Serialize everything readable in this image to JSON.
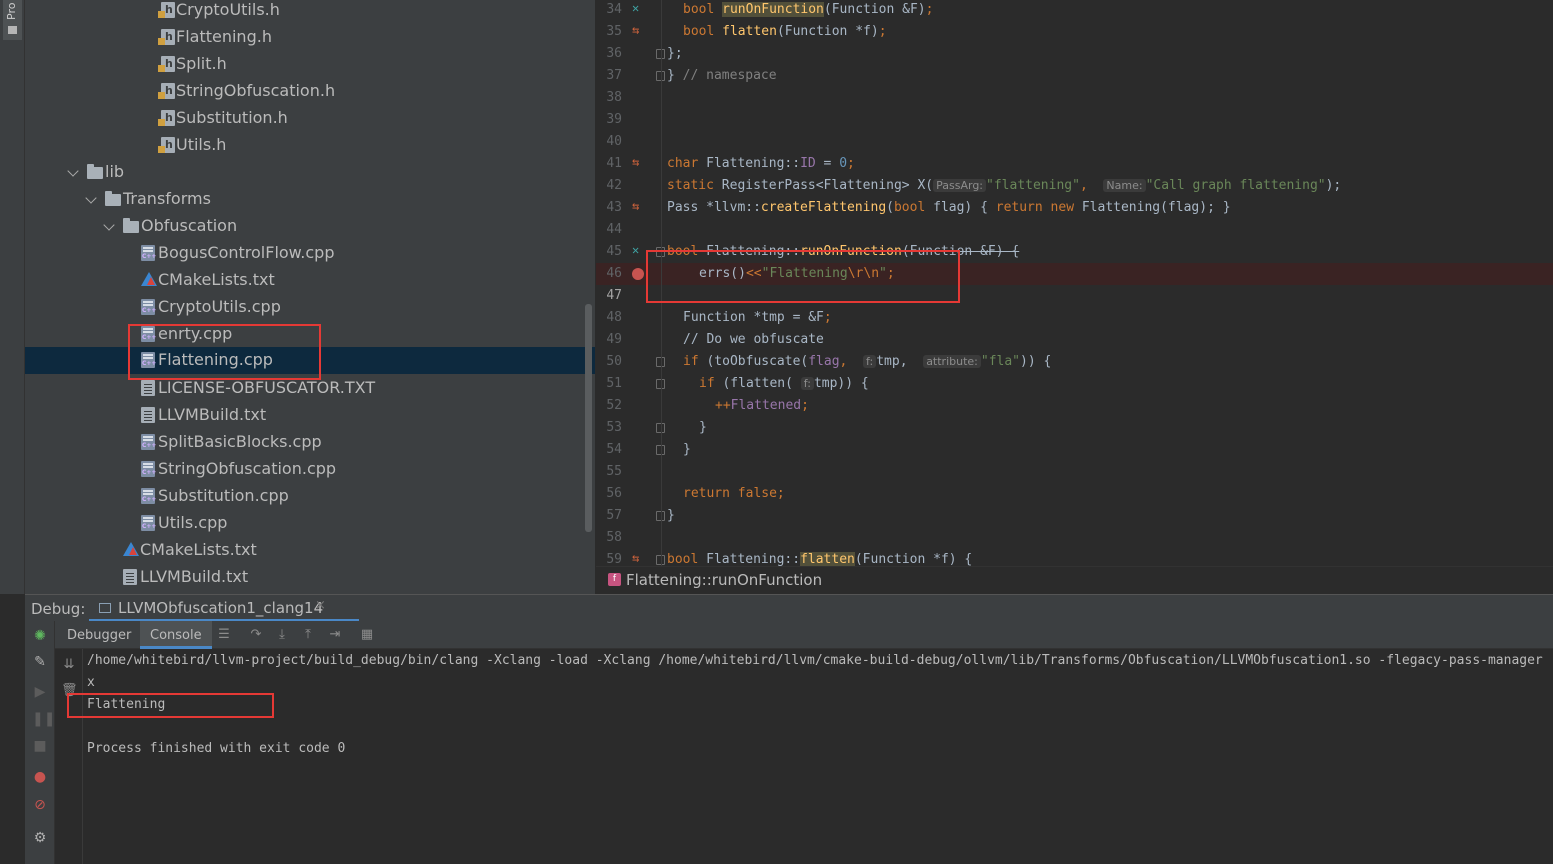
{
  "side_tab": {
    "label": "Pro"
  },
  "tree": {
    "rows": [
      {
        "label": "CryptoUtils.h",
        "type": "h"
      },
      {
        "label": "Flattening.h",
        "type": "h"
      },
      {
        "label": "Split.h",
        "type": "h"
      },
      {
        "label": "StringObfuscation.h",
        "type": "h"
      },
      {
        "label": "Substitution.h",
        "type": "h"
      },
      {
        "label": "Utils.h",
        "type": "h"
      },
      {
        "label": "lib",
        "type": "folder"
      },
      {
        "label": "Transforms",
        "type": "folder"
      },
      {
        "label": "Obfuscation",
        "type": "folder"
      },
      {
        "label": "BogusControlFlow.cpp",
        "type": "cpp"
      },
      {
        "label": "CMakeLists.txt",
        "type": "cmake"
      },
      {
        "label": "CryptoUtils.cpp",
        "type": "cpp"
      },
      {
        "label": "enrty.cpp",
        "type": "cpp"
      },
      {
        "label": "Flattening.cpp",
        "type": "cpp",
        "selected": true
      },
      {
        "label": "LICENSE-OBFUSCATOR.TXT",
        "type": "txt"
      },
      {
        "label": "LLVMBuild.txt",
        "type": "txt"
      },
      {
        "label": "SplitBasicBlocks.cpp",
        "type": "cpp"
      },
      {
        "label": "StringObfuscation.cpp",
        "type": "cpp"
      },
      {
        "label": "Substitution.cpp",
        "type": "cpp"
      },
      {
        "label": "Utils.cpp",
        "type": "cpp"
      },
      {
        "label": "CMakeLists.txt",
        "type": "cmake"
      },
      {
        "label": "LLVMBuild.txt",
        "type": "txt"
      }
    ]
  },
  "editor": {
    "line_numbers": [
      "34",
      "35",
      "36",
      "37",
      "38",
      "39",
      "40",
      "41",
      "42",
      "43",
      "44",
      "45",
      "46",
      "47",
      "48",
      "49",
      "50",
      "51",
      "52",
      "53",
      "54",
      "55",
      "56",
      "57",
      "58",
      "59"
    ],
    "hints": {
      "pass_arg": "PassArg:",
      "name": "Name:",
      "f": "f:",
      "attribute": "attribute:"
    },
    "tokens": {
      "l34_kw": "bool ",
      "l34_fn": "runOnFunction",
      "l34_rest": "(Function &F)",
      "l34_semi": ";",
      "l35_kw": "bool ",
      "l35_fn": "flatten",
      "l35_rest": "(Function *f)",
      "l35_semi": ";",
      "l36": "};",
      "l37_a": "} ",
      "l37_cm": "// namespace",
      "l41_kw": "char ",
      "l41_a": "Flattening::",
      "l41_id": "ID",
      "l41_b": " = ",
      "l41_num": "0",
      "l41_semi": ";",
      "l42_kw": "static ",
      "l42_a": "RegisterPass<Flattening> ",
      "l42_x": "X(",
      "l42_s1": "\"flattening\"",
      "l42_c": ", ",
      "l42_s2": "\"Call graph flattening\"",
      "l42_e": ");",
      "l43_a": "Pass *llvm::",
      "l43_fn": "createFlattening",
      "l43_b": "(",
      "l43_kw1": "bool ",
      "l43_c": "flag) { ",
      "l43_kw2": "return new ",
      "l43_d": "Flattening(flag); }",
      "l45_kw": "bool ",
      "l45_a": "Flattening::",
      "l45_fn": "runOnFunction",
      "l45_b": "(Function &F) {",
      "l46_a": "errs()",
      "l46_op": "<<",
      "l46_s1": "\"Flattening",
      "l46_esc": "\\r\\n",
      "l46_s2": "\"",
      "l46_semi": ";",
      "l48_a": "Function *tmp = &F",
      "l48_semi": ";",
      "l49_cm": "// Do we obfuscate",
      "l50_kw": "if ",
      "l50_a": "(toObfuscate(",
      "l50_v": "flag",
      "l50_b": ", ",
      "l50_c": "tmp, ",
      "l50_s": "\"fla\"",
      "l50_d": ")) {",
      "l51_kw": "if ",
      "l51_a": "(flatten( ",
      "l51_b": "tmp)) {",
      "l52_op": "++",
      "l52_v": "Flattened",
      "l52_semi": ";",
      "l53": "}",
      "l54": "}",
      "l56_kw": "return false",
      "l56_semi": ";",
      "l57": "}",
      "l59_kw": "bool ",
      "l59_a": "Flattening::",
      "l59_fn": "flatten",
      "l59_b": "(Function *f) {"
    }
  },
  "breadcrumb": {
    "badge": "f",
    "text": "Flattening::runOnFunction"
  },
  "debug": {
    "label": "Debug:",
    "session_tab": "LLVMObfuscation1_clang14",
    "close": "×",
    "tabs": {
      "debugger": "Debugger",
      "console": "Console"
    }
  },
  "console": {
    "lines": [
      "/home/whitebird/llvm-project/build_debug/bin/clang -Xclang -load -Xclang /home/whitebird/llvm/cmake-build-debug/ollvm/lib/Transforms/Obfuscation/LLVMObfuscation1.so -flegacy-pass-manager",
      "x",
      "Flattening",
      "",
      "Process finished with exit code 0"
    ]
  },
  "colors": {
    "annotation": "#e53935",
    "selection": "#0d293e",
    "breakpoint": "#c75450",
    "active_tab_underline": "#4a88c7"
  }
}
